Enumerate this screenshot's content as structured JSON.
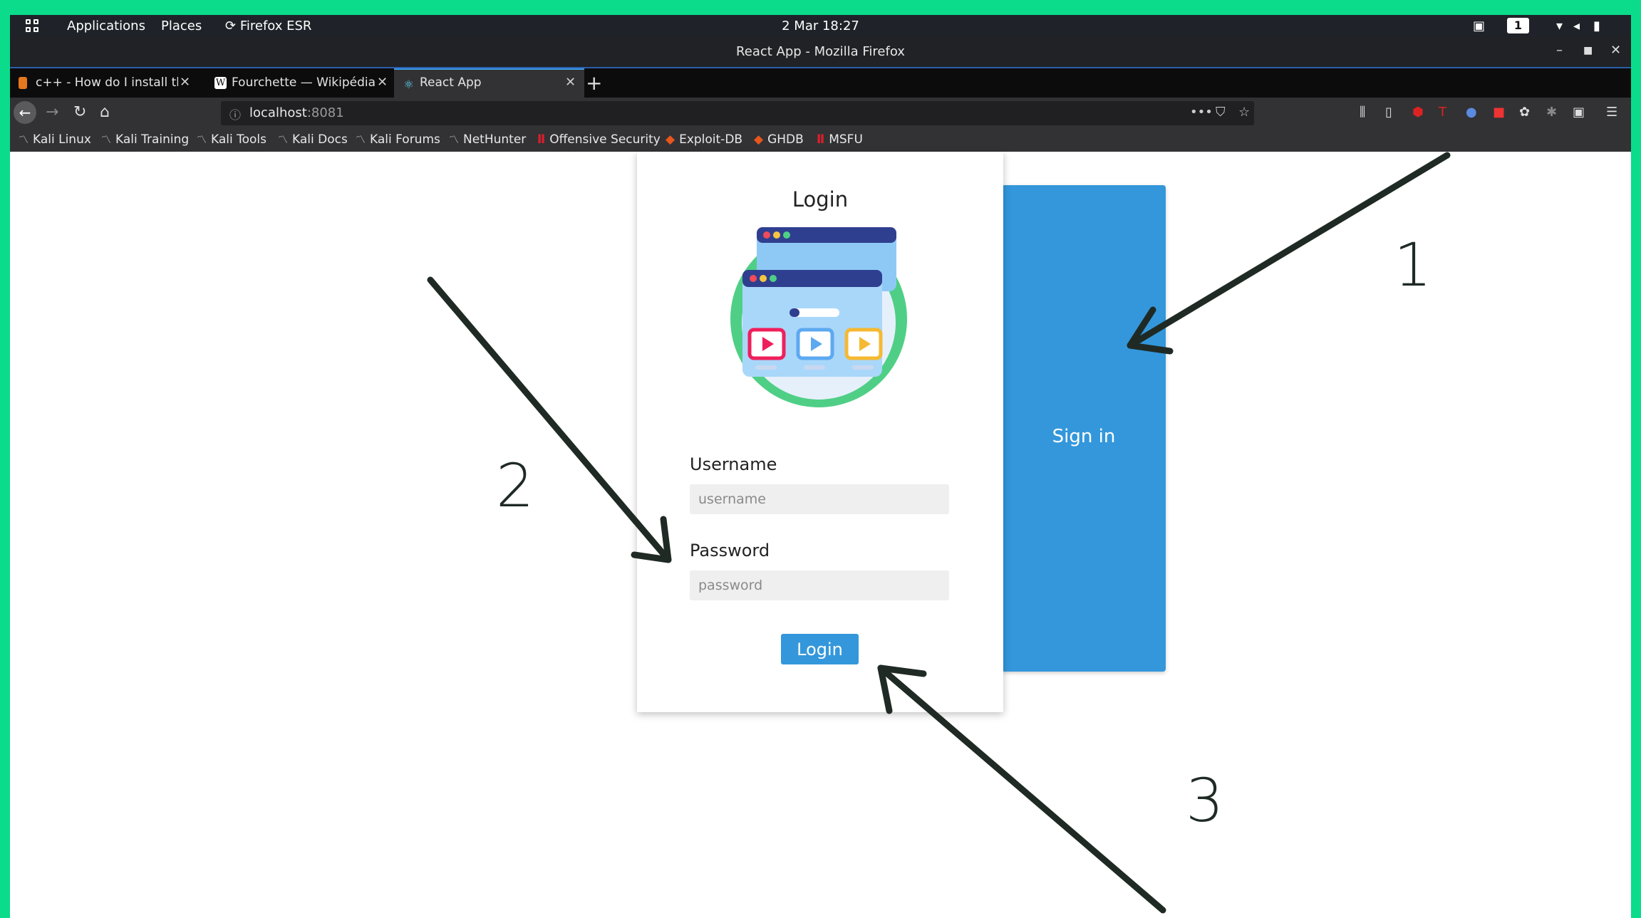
{
  "topbar": {
    "applications": "Applications",
    "places": "Places",
    "firefox": "Firefox ESR",
    "clock": "2 Mar  18:27",
    "workspace": "1"
  },
  "window": {
    "title": "React App - Mozilla Firefox"
  },
  "tabs": [
    {
      "label": "c++ - How do I install the",
      "active": false
    },
    {
      "label": "Fourchette — Wikipédia",
      "active": false
    },
    {
      "label": "React App",
      "active": true
    }
  ],
  "urlbar": {
    "host": "localhost",
    "port": ":8081"
  },
  "bookmarks": [
    "Kali Linux",
    "Kali Training",
    "Kali Tools",
    "Kali Docs",
    "Kali Forums",
    "NetHunter",
    "Offensive Security",
    "Exploit-DB",
    "GHDB",
    "MSFU"
  ],
  "login": {
    "title": "Login",
    "username_label": "Username",
    "username_placeholder": "username",
    "password_label": "Password",
    "password_placeholder": "password",
    "button": "Login"
  },
  "signin_panel": {
    "label": "Sign in"
  },
  "annotations": {
    "one": "1",
    "two": "2",
    "three": "3"
  },
  "colors": {
    "accent": "#3497db",
    "frame": "#0adc8c",
    "arrow": "#1f2a25"
  }
}
